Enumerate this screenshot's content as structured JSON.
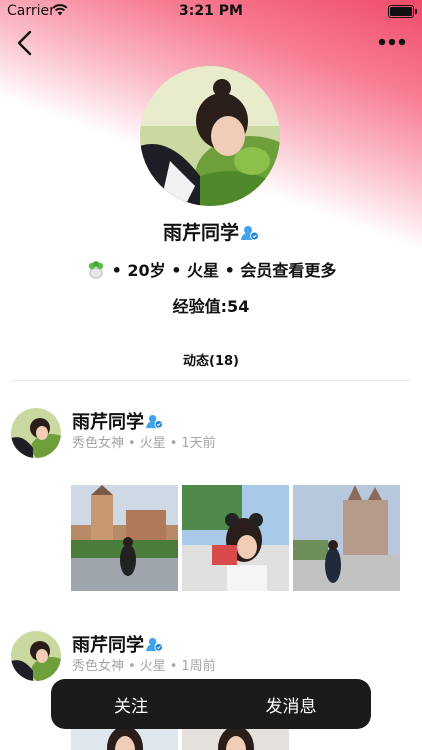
{
  "status": {
    "carrier": "Carrier",
    "time": "3:21 PM"
  },
  "colors": {
    "accent": "#f04a6a",
    "verified": "#3fa4f0",
    "meta_text": "#a5a5a5",
    "action_bar": "#1b1b1b"
  },
  "profile": {
    "name": "雨芹同学",
    "info": "• 20岁 • 火星 • 会员查看更多",
    "experience": "经验值:54"
  },
  "feed_tab": "动态(18)",
  "posts": [
    {
      "name": "雨芹同学",
      "tag": "秀色女神",
      "location": "火星",
      "time": "1天前"
    },
    {
      "name": "雨芹同学",
      "tag": "秀色女神",
      "location": "火星",
      "time": "1周前"
    }
  ],
  "actions": {
    "follow": "关注",
    "message": "发消息"
  },
  "icons": [
    "back-arrow-icon",
    "more-dots-icon",
    "verified-badge-icon",
    "plant-icon",
    "wifi-icon",
    "battery-icon"
  ]
}
